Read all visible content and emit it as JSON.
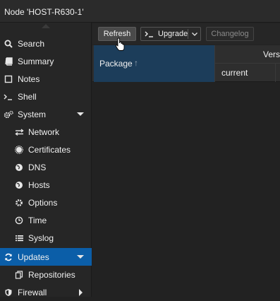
{
  "window": {
    "title": "Node 'HOST-R630-1'"
  },
  "sidebar": {
    "items": [
      {
        "label": "Search",
        "icon": "search-icon"
      },
      {
        "label": "Summary",
        "icon": "book-icon"
      },
      {
        "label": "Notes",
        "icon": "note-icon"
      },
      {
        "label": "Shell",
        "icon": "terminal-icon"
      },
      {
        "label": "System",
        "icon": "gears-icon"
      },
      {
        "label": "Network",
        "icon": "exchange-icon"
      },
      {
        "label": "Certificates",
        "icon": "certificate-icon"
      },
      {
        "label": "DNS",
        "icon": "globe-icon"
      },
      {
        "label": "Hosts",
        "icon": "globe-icon"
      },
      {
        "label": "Options",
        "icon": "gear-icon"
      },
      {
        "label": "Time",
        "icon": "clock-icon"
      },
      {
        "label": "Syslog",
        "icon": "list-icon"
      },
      {
        "label": "Updates",
        "icon": "refresh-icon"
      },
      {
        "label": "Repositories",
        "icon": "files-icon"
      },
      {
        "label": "Firewall",
        "icon": "shield-icon"
      }
    ]
  },
  "toolbar": {
    "refresh_label": "Refresh",
    "upgrade_label": "Upgrade",
    "changelog_label": "Changelog"
  },
  "grid": {
    "columns": {
      "package": "Package",
      "version_group": "Versi",
      "current": "current"
    },
    "sort_indicator": "↑"
  },
  "colors": {
    "selected": "#0b5ea8",
    "sorted_header": "#1c3d5a"
  }
}
